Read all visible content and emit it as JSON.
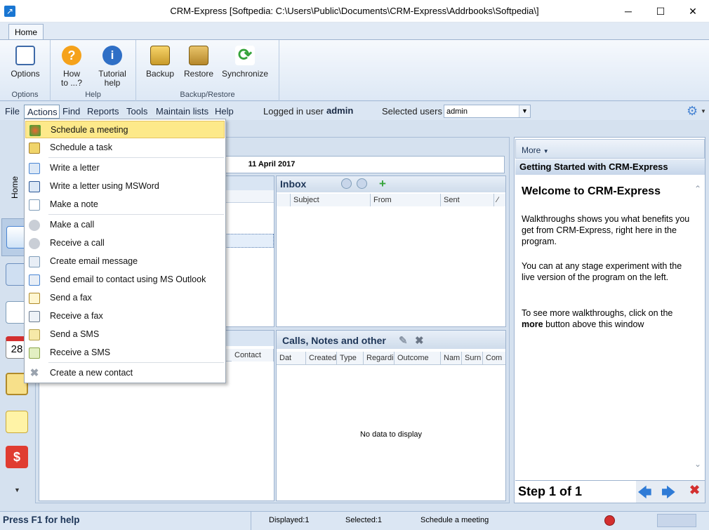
{
  "window": {
    "title": "CRM-Express [Softpedia: C:\\Users\\Public\\Documents\\CRM-Express\\Addrbooks\\Softpedia\\]",
    "controls": {
      "minimize": "─",
      "maximize": "☐",
      "close": "✕"
    }
  },
  "ribbon": {
    "tab": "Home",
    "groups": [
      {
        "label": "Options",
        "buttons": [
          {
            "label": "Options",
            "icon": "options-icon"
          }
        ]
      },
      {
        "label": "Help",
        "buttons": [
          {
            "label": "How to ...?",
            "line1": "How",
            "line2": "to ...?",
            "icon": "question-icon"
          },
          {
            "label": "Tutorial help",
            "line1": "Tutorial",
            "line2": "help",
            "icon": "info-icon"
          }
        ]
      },
      {
        "label": "Backup/Restore",
        "buttons": [
          {
            "label": "Backup",
            "icon": "backup-icon"
          },
          {
            "label": "Restore",
            "icon": "restore-icon"
          },
          {
            "label": "Synchronize",
            "icon": "sync-icon"
          }
        ]
      }
    ]
  },
  "menubar": {
    "items": [
      "File",
      "Actions",
      "Find",
      "Reports",
      "Tools",
      "Maintain lists",
      "Help"
    ],
    "logged_in_label": "Logged in user",
    "logged_in_user": "admin",
    "selected_users_label": "Selected users",
    "selected_users_value": "admin"
  },
  "sidebar": {
    "home_label": "Home",
    "calendar_day": "28"
  },
  "calendar": {
    "date": "11 April 2017"
  },
  "inbox": {
    "title": "Inbox",
    "columns": [
      "Subject",
      "From",
      "Sent"
    ]
  },
  "contacts_fragment": {
    "column": "Contact"
  },
  "calls": {
    "title": "Calls, Notes and other",
    "columns": [
      "Dat",
      "Created",
      "Type",
      "Regardi",
      "Outcome",
      "Nam",
      "Surn",
      "Com"
    ],
    "empty_text": "No data to display"
  },
  "help_pane": {
    "more_label": "More",
    "header": "Getting Started with CRM-Express",
    "heading": "Welcome to CRM-Express",
    "paragraph1": "Walkthroughs shows you what benefits you get from CRM-Express, right here in the program.",
    "paragraph2": "You can at any stage experiment with the live version of the program on the left.",
    "paragraph3_prefix": "To see more walkthroughs, click on the",
    "paragraph3_bold": "more",
    "paragraph3_suffix": "button above this window",
    "step_text": "Step 1 of 1"
  },
  "actions_menu": {
    "items": [
      {
        "label": "Schedule a meeting",
        "icon": "meeting-icon",
        "highlighted": true
      },
      {
        "label": "Schedule a task",
        "icon": "task-icon"
      },
      {
        "label": "Write a letter",
        "icon": "letter-icon"
      },
      {
        "label": "Write a letter using MSWord",
        "icon": "word-letter-icon"
      },
      {
        "label": "Make a note",
        "icon": "note-icon"
      },
      {
        "label": "Make a call",
        "icon": "phone-out-icon"
      },
      {
        "label": "Receive a call",
        "icon": "phone-in-icon"
      },
      {
        "label": "Create email message",
        "icon": "email-icon"
      },
      {
        "label": "Send email to contact using MS Outlook",
        "icon": "outlook-icon"
      },
      {
        "label": "Send a fax",
        "icon": "fax-send-icon"
      },
      {
        "label": "Receive a fax",
        "icon": "fax-receive-icon"
      },
      {
        "label": "Send a SMS",
        "icon": "sms-send-icon"
      },
      {
        "label": "Receive a SMS",
        "icon": "sms-receive-icon"
      },
      {
        "label": "Create a new contact",
        "icon": "new-contact-icon"
      }
    ]
  },
  "status": {
    "help": "Press F1 for help",
    "displayed": "Displayed:1",
    "selected": "Selected:1",
    "action": "Schedule a meeting"
  },
  "colors": {
    "accent": "#1976d2",
    "highlight": "#fde98a",
    "panel_border": "#9db3cf",
    "close_red": "#d32f2f"
  }
}
